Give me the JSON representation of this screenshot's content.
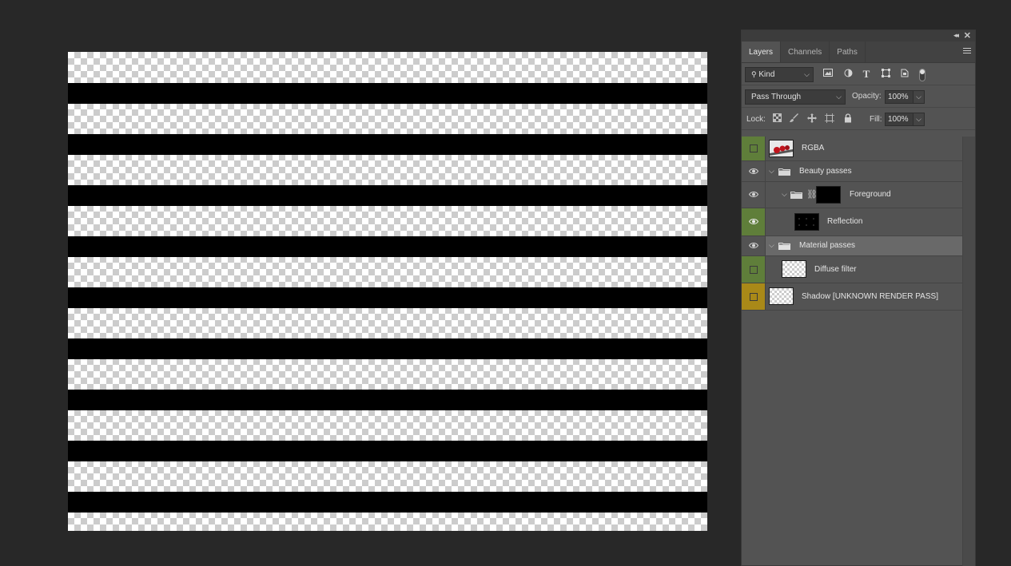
{
  "panel": {
    "tabs": [
      {
        "label": "Layers"
      },
      {
        "label": "Channels"
      },
      {
        "label": "Paths"
      }
    ],
    "filter": {
      "kind_label": "Kind"
    },
    "blend": {
      "mode": "Pass Through",
      "opacity_label": "Opacity:",
      "opacity_value": "100%"
    },
    "lock": {
      "label": "Lock:",
      "fill_label": "Fill:",
      "fill_value": "100%"
    },
    "layers": [
      {
        "name": "RGBA",
        "visibility": "green-box"
      },
      {
        "name": "Beauty passes",
        "type": "group"
      },
      {
        "name": "Foreground",
        "type": "group-masked"
      },
      {
        "name": "Reflection"
      },
      {
        "name": "Material passes",
        "type": "group",
        "selected": true
      },
      {
        "name": "Diffuse filter",
        "visibility": "green-box"
      },
      {
        "name": "Shadow [UNKNOWN RENDER PASS]",
        "visibility": "yellow-box"
      }
    ]
  },
  "colors": {
    "background": "#282828",
    "panel": "#535353",
    "visibility_green": "#5f7e3a",
    "visibility_yellow": "#a98918"
  }
}
